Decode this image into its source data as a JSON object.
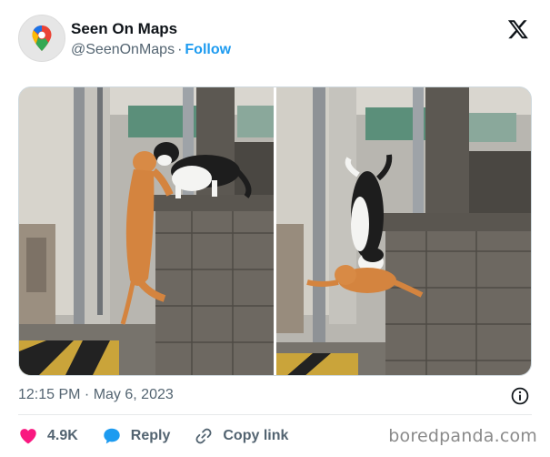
{
  "post": {
    "display_name": "Seen On Maps",
    "handle": "@SeenOnMaps",
    "separator": "·",
    "follow_label": "Follow",
    "timestamp": "12:15 PM · May 6, 2023"
  },
  "actions": {
    "like_count": "4.9K",
    "reply_label": "Reply",
    "copy_link_label": "Copy link"
  },
  "watermark": "boredpanda.com",
  "colors": {
    "accent": "#1d9bf0",
    "like": "#f91880",
    "reply": "#1d9bf0",
    "text_secondary": "#536471"
  },
  "icons": {
    "avatar": "google-maps-pin-icon",
    "brand": "x-logo-icon",
    "info": "info-icon",
    "like": "heart-icon",
    "reply": "speech-bubble-icon",
    "copy_link": "link-icon"
  }
}
